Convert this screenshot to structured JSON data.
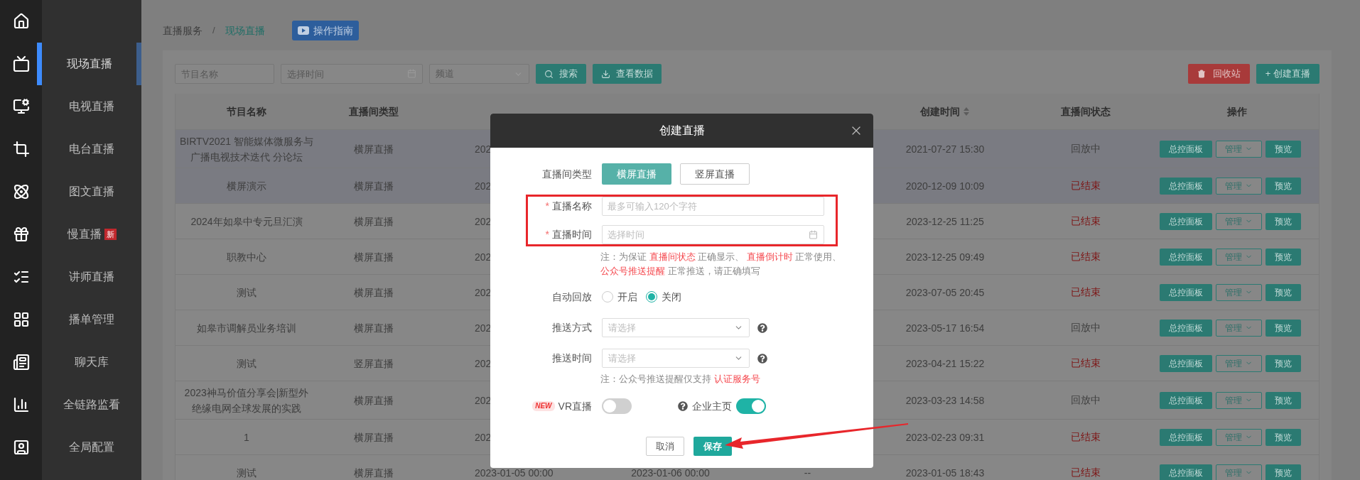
{
  "rail": [
    {
      "selected": false
    },
    {
      "selected": true
    },
    {
      "selected": false
    },
    {
      "selected": false
    },
    {
      "selected": false
    },
    {
      "selected": false
    },
    {
      "selected": false
    },
    {
      "selected": false
    },
    {
      "selected": false
    },
    {
      "selected": false
    },
    {
      "selected": false
    }
  ],
  "menu": [
    {
      "label": "现场直播",
      "selected": true
    },
    {
      "label": "电视直播",
      "selected": false
    },
    {
      "label": "电台直播",
      "selected": false
    },
    {
      "label": "图文直播",
      "selected": false
    },
    {
      "label": "慢直播",
      "badge": "新",
      "selected": false
    },
    {
      "label": "讲师直播",
      "selected": false
    },
    {
      "label": "播单管理",
      "selected": false
    },
    {
      "label": "聊天库",
      "selected": false
    },
    {
      "label": "全链路监看",
      "selected": false
    },
    {
      "label": "全局配置",
      "selected": false
    }
  ],
  "breadcrumb": {
    "items": [
      {
        "label": "直播服务",
        "selected": false
      },
      {
        "label": "现场直播",
        "selected": true
      }
    ],
    "separator": "/"
  },
  "guide_button": "操作指南",
  "filters": {
    "name_placeholder": "节目名称",
    "time_placeholder": "选择时间",
    "channel_placeholder": "频道"
  },
  "toolbar_buttons": [
    {
      "label": "搜索",
      "kind": "search"
    },
    {
      "label": "查看数据",
      "kind": "download"
    }
  ],
  "right_buttons": [
    {
      "label": "回收站",
      "kind": "trash"
    },
    {
      "label": "+ 创建直播",
      "kind": "create"
    }
  ],
  "table": {
    "columns": [
      {
        "label": "节目名称",
        "sortable": false
      },
      {
        "label": "直播间类型",
        "sortable": false
      },
      {},
      {},
      {},
      {
        "label": "创建时间",
        "sortable": true
      },
      {
        "label": "直播间状态",
        "sortable": false
      },
      {
        "label": "操作",
        "sortable": false
      }
    ],
    "rows": [
      {
        "name": "BIRTV2021 智能媒体微服务与广播电视技术迭代 分论坛",
        "type": "横屏直播",
        "start": "202",
        "created": "2021-07-27 15:30",
        "status": {
          "text": "回放中",
          "color": "#404040"
        },
        "actions": [
          "总控面板",
          "管理",
          "预览"
        ],
        "selected": true
      },
      {
        "name": "横屏演示",
        "type": "横屏直播",
        "start": "202",
        "created": "2020-12-09 10:09",
        "status": {
          "text": "已结束",
          "color": "#7d1414"
        },
        "actions": [
          "总控面板",
          "管理",
          "预览"
        ],
        "selected": true
      },
      {
        "name": "2024年如皋中专元旦汇演",
        "type": "横屏直播",
        "start": "202",
        "created": "2023-12-25 11:25",
        "status": {
          "text": "已结束",
          "color": "#7d1414"
        },
        "actions": [
          "总控面板",
          "管理",
          "预览"
        ],
        "selected": false
      },
      {
        "name": "职教中心",
        "type": "横屏直播",
        "start": "202",
        "created": "2023-12-25 09:49",
        "status": {
          "text": "已结束",
          "color": "#7d1414"
        },
        "actions": [
          "总控面板",
          "管理",
          "预览"
        ],
        "selected": false
      },
      {
        "name": "测试",
        "type": "横屏直播",
        "start": "202",
        "created": "2023-07-05 20:45",
        "status": {
          "text": "已结束",
          "color": "#7d1414"
        },
        "actions": [
          "总控面板",
          "管理",
          "预览"
        ],
        "selected": false
      },
      {
        "name": "如皋市调解员业务培训",
        "type": "横屏直播",
        "start": "202",
        "created": "2023-05-17 16:54",
        "status": {
          "text": "回放中",
          "color": "#404040"
        },
        "actions": [
          "总控面板",
          "管理",
          "预览"
        ],
        "selected": false
      },
      {
        "name": "测试",
        "type": "竖屏直播",
        "start": "202",
        "created": "2023-04-21 15:22",
        "status": {
          "text": "已结束",
          "color": "#7d1414"
        },
        "actions": [
          "总控面板",
          "管理",
          "预览"
        ],
        "selected": false
      },
      {
        "name": "2023神马价值分享会|新型外绝缘电网全球发展的实践",
        "type": "横屏直播",
        "start": "202",
        "created": "2023-03-23 14:58",
        "status": {
          "text": "回放中",
          "color": "#404040"
        },
        "actions": [
          "总控面板",
          "管理",
          "预览"
        ],
        "selected": false
      },
      {
        "name": "1",
        "type": "横屏直播",
        "start": "202",
        "created": "2023-02-23 09:31",
        "status": {
          "text": "已结束",
          "color": "#7d1414"
        },
        "actions": [
          "总控面板",
          "管理",
          "预览"
        ],
        "selected": false
      },
      {
        "name": "测试",
        "type": "横屏直播",
        "start": "2023-01-05 00:00",
        "end": "2023-01-06 00:00",
        "channel": "--",
        "created": "2023-01-05 18:43",
        "status": {
          "text": "已结束",
          "color": "#7d1414"
        },
        "actions": [
          "总控面板",
          "管理",
          "预览"
        ],
        "selected": false
      }
    ]
  },
  "dialog": {
    "title": "创建直播",
    "room_type": {
      "label": "直播间类型",
      "options": [
        {
          "label": "横屏直播",
          "selected": true
        },
        {
          "label": "竖屏直播",
          "selected": false
        }
      ]
    },
    "name_field": {
      "label": "直播名称",
      "required_mark": "*",
      "placeholder": "最多可输入120个字符"
    },
    "time_field": {
      "label": "直播时间",
      "required_mark": "*",
      "placeholder": "选择时间"
    },
    "note": [
      {
        "text": "注：为保证 ",
        "highlight": false
      },
      {
        "text": "直播间状态",
        "highlight": true
      },
      {
        "text": " 正确显示、 ",
        "highlight": false
      },
      {
        "text": "直播倒计时",
        "highlight": true
      },
      {
        "text": " 正常使用、 ",
        "highlight": false
      },
      {
        "text": "公众号推送提醒",
        "highlight": true
      },
      {
        "text": " 正常推送，请正确填写",
        "highlight": false
      }
    ],
    "auto_replay": {
      "label": "自动回放",
      "options": [
        {
          "label": "开启",
          "selected": false
        },
        {
          "label": "关闭",
          "selected": true
        }
      ]
    },
    "push_method": {
      "label": "推送方式",
      "placeholder": "请选择"
    },
    "push_time": {
      "label": "推送时间",
      "placeholder": "请选择"
    },
    "note2": [
      {
        "text": "注：公众号推送提醒仅支持 ",
        "highlight": false
      },
      {
        "text": "认证服务号",
        "highlight": true
      }
    ],
    "vr": {
      "badge": "NEW",
      "label": "VR直播",
      "on": false
    },
    "company": {
      "label": "企业主页",
      "on": true
    },
    "buttons": [
      {
        "label": "取消",
        "kind": "cancel"
      },
      {
        "label": "保存",
        "kind": "primary"
      }
    ]
  }
}
